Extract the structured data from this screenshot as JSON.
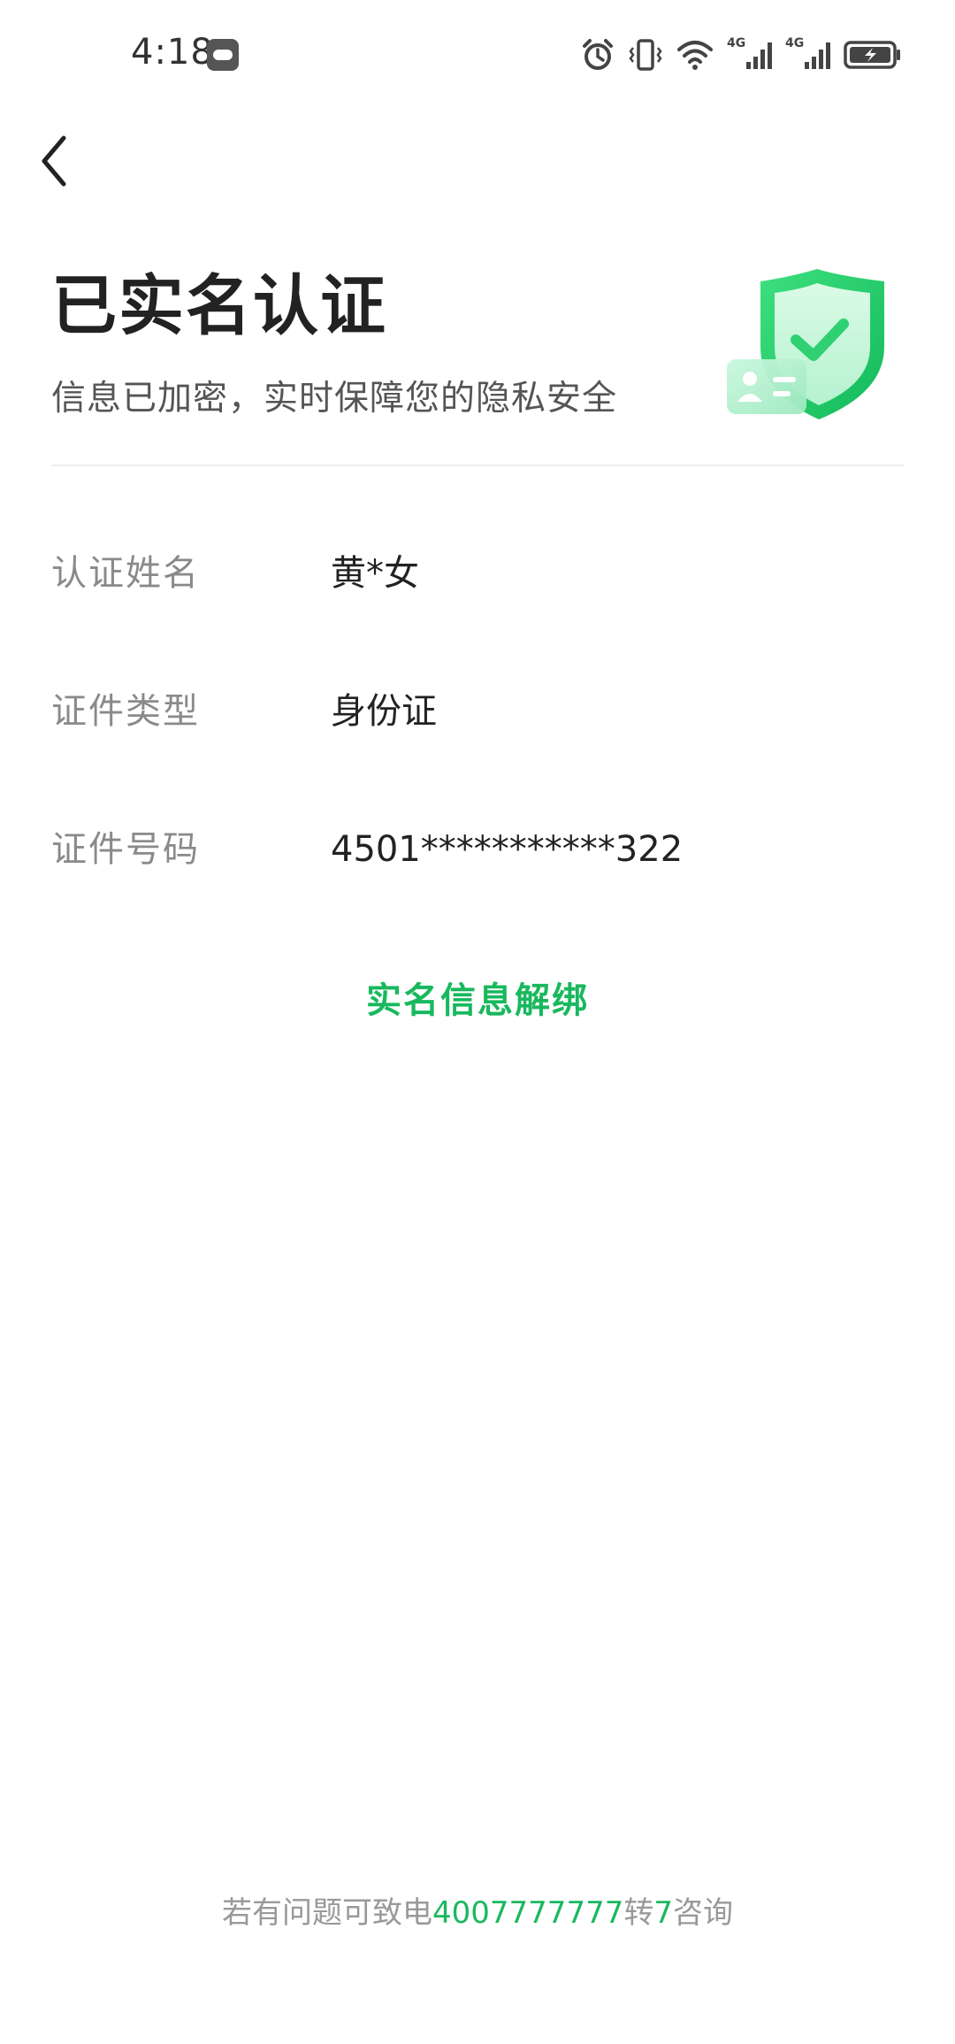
{
  "status_bar": {
    "time": "4:18",
    "icons": [
      "fish-app-icon",
      "alarm-icon",
      "vibrate-icon",
      "wifi-icon",
      "4g-signal-icon",
      "4g-signal-icon",
      "battery-charging-icon"
    ],
    "network_label_1": "4G",
    "network_label_2": "4G"
  },
  "nav": {
    "back_icon": "chevron-left-icon"
  },
  "header": {
    "title": "已实名认证",
    "subtitle": "信息已加密，实时保障您的隐私安全",
    "illustration": "shield-check-id-card-icon"
  },
  "info": {
    "rows": [
      {
        "label": "认证姓名",
        "value": "黄*女"
      },
      {
        "label": "证件类型",
        "value": "身份证"
      },
      {
        "label": "证件号码",
        "value": "4501***********322"
      }
    ]
  },
  "actions": {
    "unbind_label": "实名信息解绑"
  },
  "footer": {
    "prefix": "若有问题可致电",
    "phone": "4007777777",
    "middle": "转",
    "extension": "7",
    "suffix": "咨询"
  },
  "colors": {
    "accent": "#19b85e",
    "label_gray": "#8a8a8a",
    "title": "#222222",
    "background": "#ffffff"
  }
}
